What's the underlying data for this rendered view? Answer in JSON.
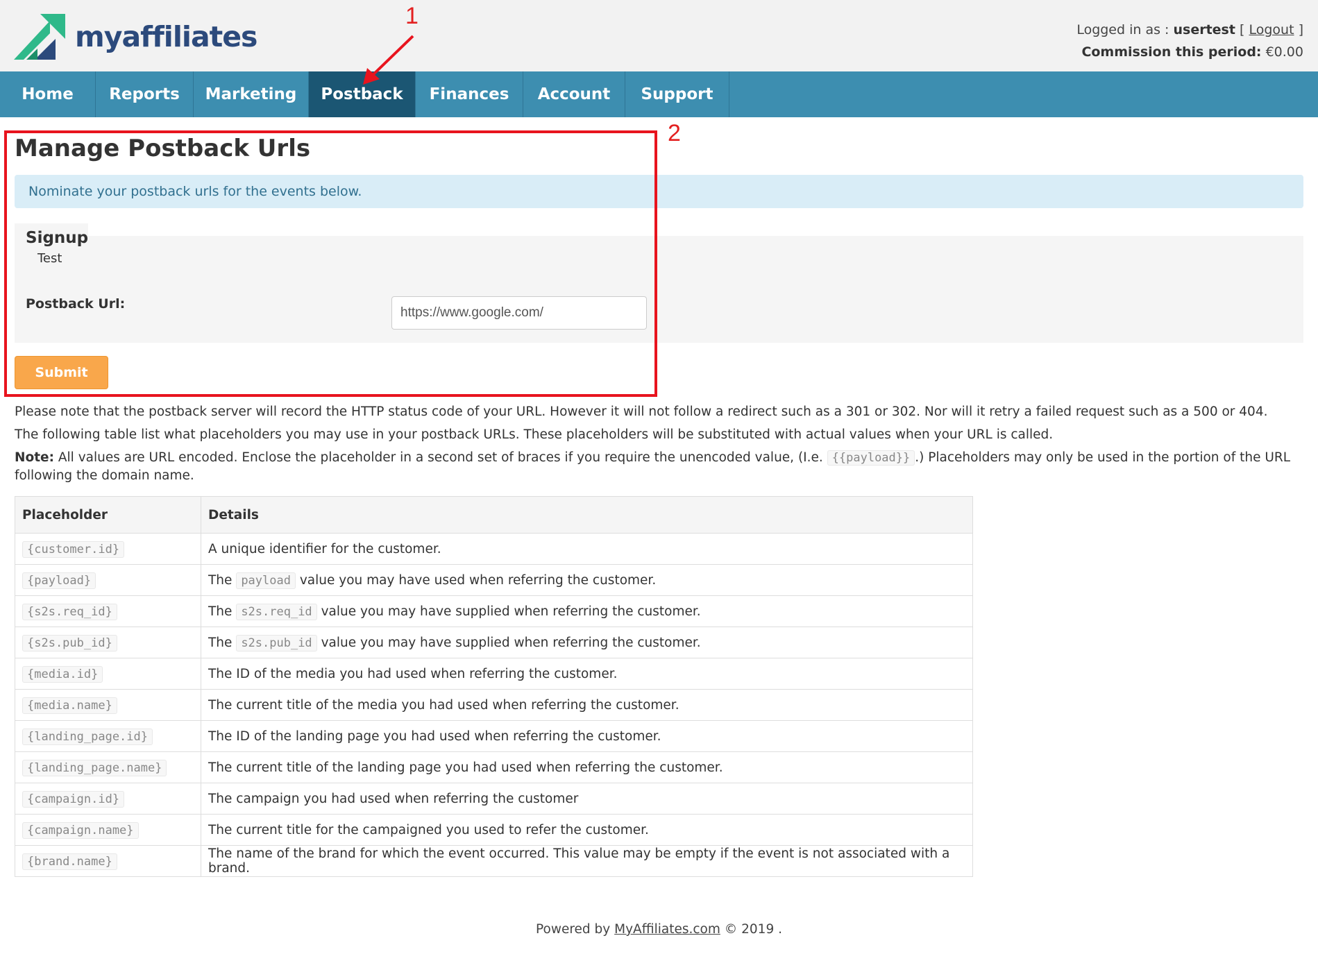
{
  "brand": {
    "logo_text": "myaffiliates",
    "logo_colors": [
      "#2fb98a",
      "#2c4a7c"
    ]
  },
  "user": {
    "logged_in_label": "Logged in as :",
    "username": "usertest",
    "logout_open": "[",
    "logout_label": "Logout",
    "logout_close": "]",
    "commission_label": "Commission this period:",
    "commission_value": "€0.00"
  },
  "nav": {
    "items": [
      {
        "label": "Home"
      },
      {
        "label": "Reports"
      },
      {
        "label": "Marketing"
      },
      {
        "label": "Postback",
        "active": true
      },
      {
        "label": "Finances"
      },
      {
        "label": "Account"
      },
      {
        "label": "Support"
      }
    ],
    "background": "#3d8eb0",
    "active_background": "#1b5673"
  },
  "annotations": {
    "num1": "1",
    "num2": "2",
    "color": "#e8141e"
  },
  "main": {
    "title": "Manage Postback Urls",
    "info": "Nominate your postback urls for the events below.",
    "event_title": "Signup",
    "event_sub": "Test",
    "postback_label": "Postback Url:",
    "postback_value": "https://www.google.com/",
    "submit_label": "Submit",
    "submit_color": "#f9a74b",
    "note1": "Please note that the postback server will record the HTTP status code of your URL. However it will not follow a redirect such as a 301 or 302. Nor will it retry a failed request such as a 500 or 404.",
    "note2": "The following table list what placeholders you may use in your postback URLs. These placeholders will be substituted with actual values when your URL is called.",
    "note3_label": "Note:",
    "note3_a": "All values are URL encoded. Enclose the placeholder in a second set of braces if you require the unencoded value, (I.e.",
    "note3_code": "{{payload}}",
    "note3_b": ".) Placeholders may only be used in the portion of the URL",
    "note3_c": "following the domain name."
  },
  "table": {
    "headers": [
      "Placeholder",
      "Details"
    ],
    "rows": [
      {
        "placeholder": "{customer.id}",
        "details": "A unique identifier for the customer."
      },
      {
        "placeholder": "{payload}",
        "pre": "The",
        "code": "payload",
        "post": "value you may have used when referring the customer."
      },
      {
        "placeholder": "{s2s.req_id}",
        "pre": "The",
        "code": "s2s.req_id",
        "post": "value you may have supplied when referring the customer."
      },
      {
        "placeholder": "{s2s.pub_id}",
        "pre": "The",
        "code": "s2s.pub_id",
        "post": "value you may have supplied when referring the customer."
      },
      {
        "placeholder": "{media.id}",
        "details": "The ID of the media you had used when referring the customer."
      },
      {
        "placeholder": "{media.name}",
        "details": "The current title of the media you had used when referring the customer."
      },
      {
        "placeholder": "{landing_page.id}",
        "details": "The ID of the landing page you had used when referring the customer."
      },
      {
        "placeholder": "{landing_page.name}",
        "details": "The current title of the landing page you had used when referring the customer."
      },
      {
        "placeholder": "{campaign.id}",
        "details": "The campaign you had used when referring the customer"
      },
      {
        "placeholder": "{campaign.name}",
        "details": "The current title for the campaigned you used to refer the customer."
      },
      {
        "placeholder": "{brand.name}",
        "details": "The name of the brand for which the event occurred. This value may be empty if the event is not associated with a brand."
      }
    ]
  },
  "footer": {
    "prefix": "Powered by",
    "link": "MyAffiliates.com",
    "suffix": "© 2019 ."
  }
}
